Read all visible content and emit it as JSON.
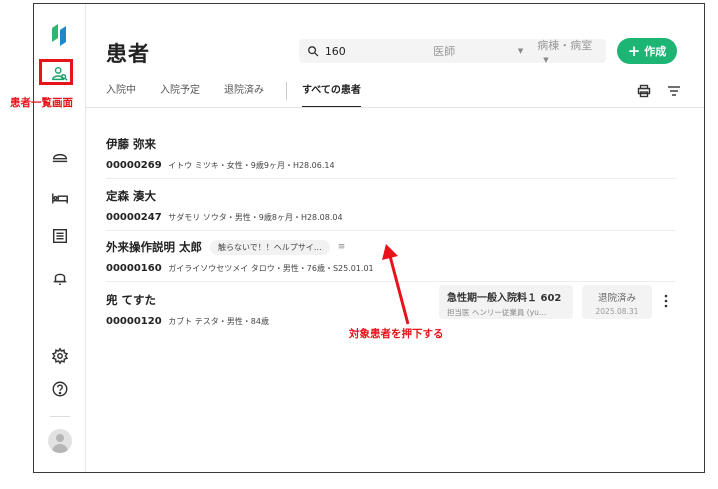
{
  "sidebar": {
    "items": [
      {
        "name": "patients",
        "icon": "patient-search-icon",
        "active": true
      },
      {
        "name": "admission",
        "icon": "dish-cover-icon"
      },
      {
        "name": "beds",
        "icon": "bed-icon"
      },
      {
        "name": "documents",
        "icon": "list-document-icon"
      },
      {
        "name": "notifications",
        "icon": "bell-icon"
      },
      {
        "name": "settings",
        "icon": "gear-icon"
      },
      {
        "name": "help",
        "icon": "help-icon"
      }
    ]
  },
  "header": {
    "title": "患者",
    "search": {
      "value": "160",
      "doctor_placeholder": "医師",
      "ward_placeholder": "病棟・病室"
    },
    "create_label": "作成"
  },
  "tabs": [
    {
      "label": "入院中",
      "active": false
    },
    {
      "label": "入院予定",
      "active": false
    },
    {
      "label": "退院済み",
      "active": false
    },
    {
      "label": "すべての患者",
      "active": true
    }
  ],
  "patients": [
    {
      "name": "伊藤 弥来",
      "id": "00000269",
      "meta": "イトウ ミツキ・女性・9歳9ヶ月・H28.06.14"
    },
    {
      "name": "定森 湊大",
      "id": "00000247",
      "meta": "サダモリ ソウタ・男性・9歳8ヶ月・H28.08.04"
    },
    {
      "name": "外来操作説明 太郎",
      "id": "00000160",
      "meta": "ガイライソウセツメイ タロウ・男性・76歳・S25.01.01",
      "note": "触らないで！！ヘルプサイ…"
    },
    {
      "name": "兜 てすた",
      "id": "00000120",
      "meta": "カブト テスタ・男性・84歳",
      "admission": {
        "title": "急性期一般入院料１ 602",
        "sub": "担当医 ヘンリー従業員 (yu…"
      },
      "status": {
        "label": "退院済み",
        "date": "2025.08.31"
      }
    }
  ],
  "annotations": {
    "sidebar_label": "患者一覧画面",
    "target_label": "対象患者を押下する",
    "color": "#e8121b"
  },
  "colors": {
    "accent": "#1cb574"
  }
}
